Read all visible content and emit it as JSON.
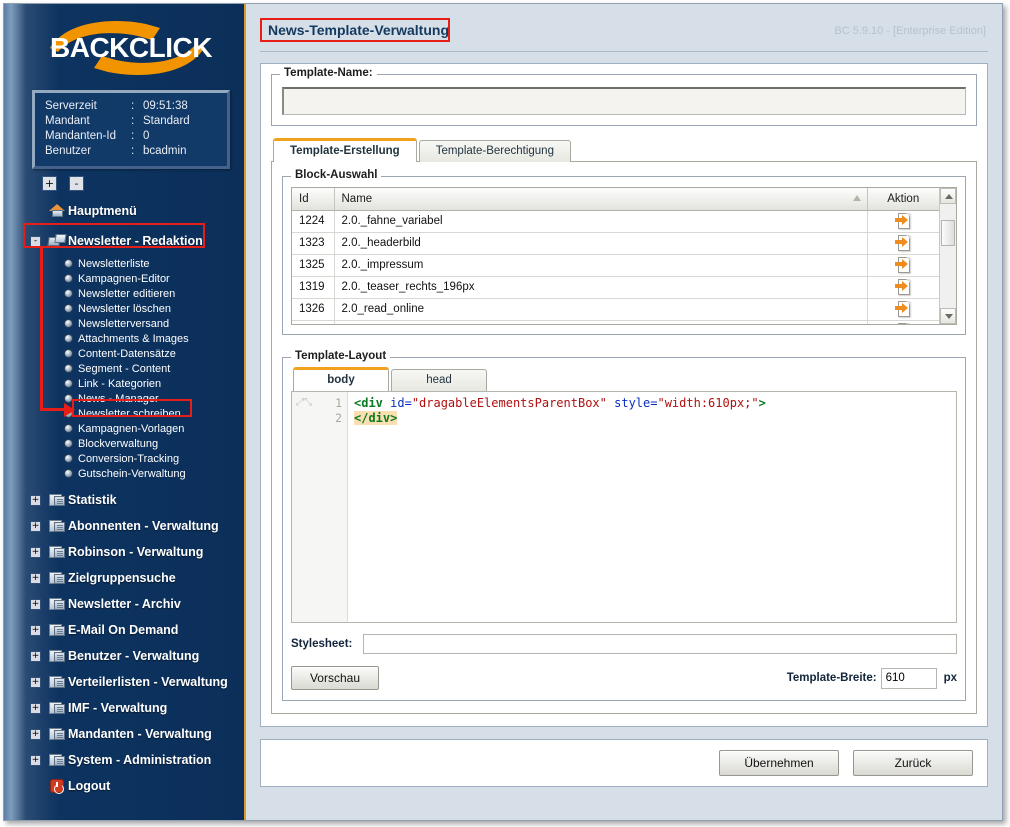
{
  "app": {
    "logo_text": "BACKCLICK",
    "version": "BC 5.9.10 - [Enterprise Edition]"
  },
  "infobox": {
    "rows": [
      {
        "key": "Serverzeit",
        "sep": ":",
        "value": "09:51:38"
      },
      {
        "key": "Mandant",
        "sep": ":",
        "value": "Standard"
      },
      {
        "key": "Mandanten-Id",
        "sep": ":",
        "value": "0"
      },
      {
        "key": "Benutzer",
        "sep": ":",
        "value": "bcadmin"
      }
    ]
  },
  "tree_controls": {
    "expand_all": "+",
    "collapse_all": "-"
  },
  "sidebar": {
    "items": [
      {
        "label": "Hauptmenü",
        "icon": "house-icon",
        "expander": "",
        "type": "top"
      },
      {
        "label": "Newsletter - Redaktion",
        "icon": "camera-icon",
        "expander": "-",
        "type": "top",
        "highlight": true
      },
      {
        "label": "Newsletterliste",
        "icon": "bullet-icon",
        "type": "sub"
      },
      {
        "label": "Kampagnen-Editor",
        "icon": "bullet-icon",
        "type": "sub"
      },
      {
        "label": "Newsletter editieren",
        "icon": "bullet-icon",
        "type": "sub"
      },
      {
        "label": "Newsletter löschen",
        "icon": "bullet-icon",
        "type": "sub"
      },
      {
        "label": "Newsletterversand",
        "icon": "bullet-icon",
        "type": "sub"
      },
      {
        "label": "Attachments & Images",
        "icon": "bullet-icon",
        "type": "sub"
      },
      {
        "label": "Content-Datensätze",
        "icon": "bullet-icon",
        "type": "sub"
      },
      {
        "label": "Segment - Content",
        "icon": "bullet-icon",
        "type": "sub"
      },
      {
        "label": "Link - Kategorien",
        "icon": "bullet-icon",
        "type": "sub"
      },
      {
        "label": "News - Manager",
        "icon": "bullet-icon",
        "type": "sub"
      },
      {
        "label": "Newsletter schreiben",
        "icon": "bullet-icon",
        "type": "sub"
      },
      {
        "label": "Kampagnen-Vorlagen",
        "icon": "bullet-icon",
        "type": "sub",
        "highlight": true
      },
      {
        "label": "Blockverwaltung",
        "icon": "bullet-icon",
        "type": "sub"
      },
      {
        "label": "Conversion-Tracking",
        "icon": "bullet-icon",
        "type": "sub"
      },
      {
        "label": "Gutschein-Verwaltung",
        "icon": "bullet-icon",
        "type": "sub"
      },
      {
        "label": "Statistik",
        "icon": "folder-icon",
        "expander": "+",
        "type": "top"
      },
      {
        "label": "Abonnenten - Verwaltung",
        "icon": "folder-icon",
        "expander": "+",
        "type": "top"
      },
      {
        "label": "Robinson - Verwaltung",
        "icon": "folder-icon",
        "expander": "+",
        "type": "top"
      },
      {
        "label": "Zielgruppensuche",
        "icon": "folder-icon",
        "expander": "+",
        "type": "top"
      },
      {
        "label": "Newsletter - Archiv",
        "icon": "folder-icon",
        "expander": "+",
        "type": "top"
      },
      {
        "label": "E-Mail On Demand",
        "icon": "folder-icon",
        "expander": "+",
        "type": "top"
      },
      {
        "label": "Benutzer - Verwaltung",
        "icon": "folder-icon",
        "expander": "+",
        "type": "top"
      },
      {
        "label": "Verteilerlisten - Verwaltung",
        "icon": "folder-icon",
        "expander": "+",
        "type": "top"
      },
      {
        "label": "IMF - Verwaltung",
        "icon": "folder-icon",
        "expander": "+",
        "type": "top"
      },
      {
        "label": "Mandanten - Verwaltung",
        "icon": "folder-icon",
        "expander": "+",
        "type": "top"
      },
      {
        "label": "System - Administration",
        "icon": "folder-icon",
        "expander": "+",
        "type": "top"
      },
      {
        "label": "Logout",
        "icon": "logout-icon",
        "expander": "",
        "type": "top"
      }
    ]
  },
  "main": {
    "page_title": "News-Template-Verwaltung",
    "template_name": {
      "legend": "Template-Name:",
      "value": "",
      "placeholder": ""
    },
    "tabs": [
      {
        "label": "Template-Erstellung",
        "active": true
      },
      {
        "label": "Template-Berechtigung",
        "active": false
      }
    ],
    "block_auswahl": {
      "legend": "Block-Auswahl",
      "columns": [
        "Id",
        "Name",
        "Aktion"
      ],
      "sorted_column": "Name",
      "rows": [
        {
          "id": "1224",
          "name": "2.0._fahne_variabel",
          "action_icon": "insert-block-icon"
        },
        {
          "id": "1323",
          "name": "2.0._headerbild",
          "action_icon": "insert-block-icon"
        },
        {
          "id": "1325",
          "name": "2.0._impressum",
          "action_icon": "insert-block-icon"
        },
        {
          "id": "1319",
          "name": "2.0._teaser_rechts_196px",
          "action_icon": "insert-block-icon"
        },
        {
          "id": "1326",
          "name": "2.0_read_online",
          "action_icon": "insert-block-icon"
        }
      ]
    },
    "template_layout": {
      "legend": "Template-Layout",
      "tabs": [
        {
          "label": "body",
          "active": true
        },
        {
          "label": "head",
          "active": false
        }
      ],
      "editor": {
        "lines": [
          "1",
          "2"
        ],
        "line1": {
          "tag_open": "<div",
          "attr1": " id=",
          "str1": "\"dragableElementsParentBox\"",
          "attr2": " style=",
          "str2": "\"width:610px;\"",
          "tag_close": ">"
        },
        "line2": "</div>"
      },
      "stylesheet": {
        "label": "Stylesheet:",
        "value": ""
      },
      "preview_button": "Vorschau",
      "width_label": "Template-Breite:",
      "width_value": "610",
      "width_unit": "px"
    }
  },
  "footer": {
    "apply_button": "Übernehmen",
    "back_button": "Zurück"
  },
  "colors": {
    "sidebar_dark": "#0b2f59",
    "accent_orange": "#e09a2a",
    "annotation_red": "#e71d18",
    "title_blue": "#13395f",
    "tab_active_top": "#f0a21e"
  }
}
